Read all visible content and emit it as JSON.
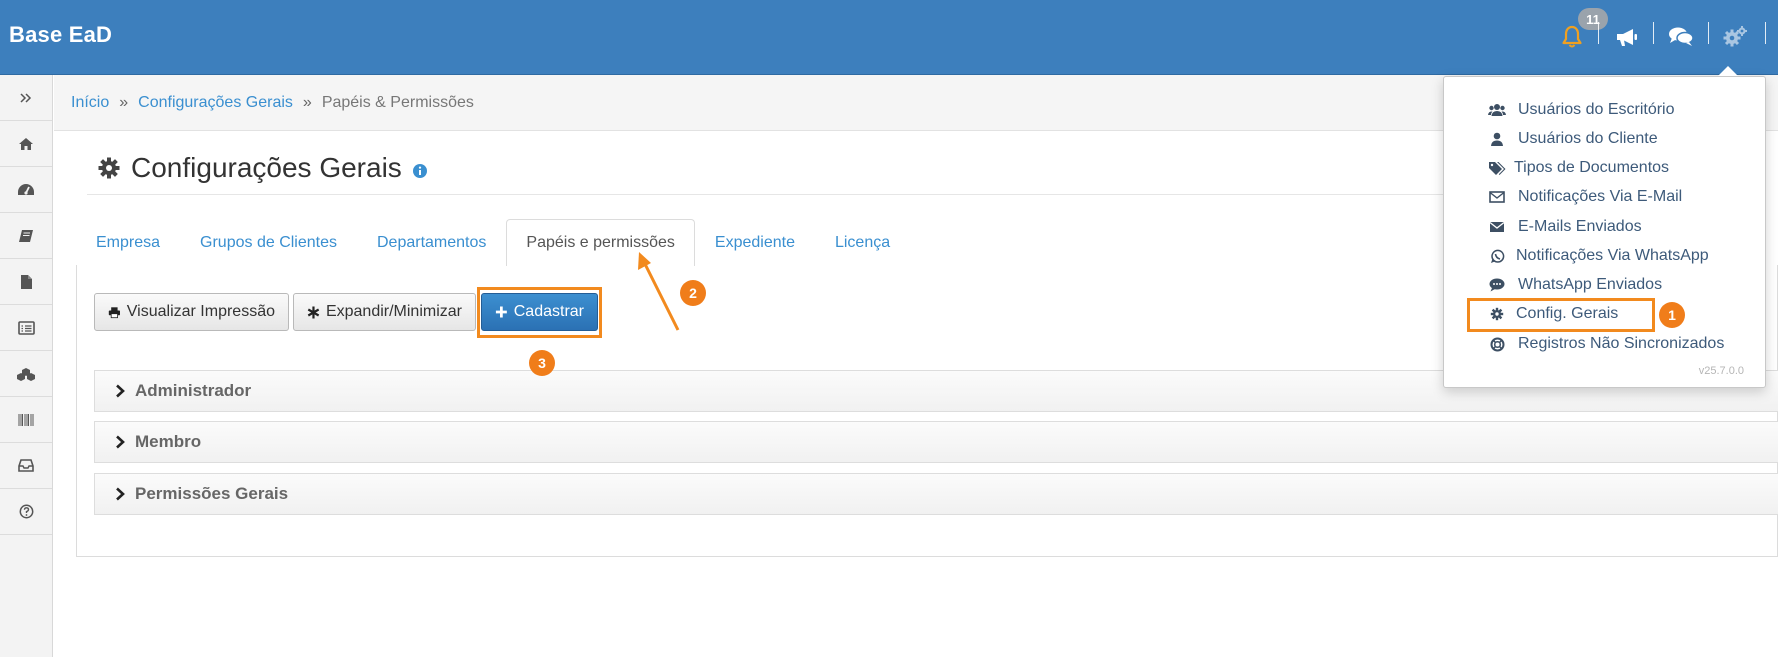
{
  "app": {
    "brand": "Base EaD"
  },
  "topbar": {
    "notification_count": "11"
  },
  "breadcrumb": {
    "items": [
      "Início",
      "Configurações Gerais",
      "Papéis & Permissões"
    ],
    "separator": "»"
  },
  "page": {
    "title": "Configurações Gerais"
  },
  "tabs": [
    {
      "label": "Empresa"
    },
    {
      "label": "Grupos de Clientes"
    },
    {
      "label": "Departamentos"
    },
    {
      "label": "Papéis e permissões",
      "active": true
    },
    {
      "label": "Expediente"
    },
    {
      "label": "Licença"
    }
  ],
  "toolbar": {
    "print_label": "Visualizar Impressão",
    "expand_label": "Expandir/Minimizar",
    "add_label": "Cadastrar"
  },
  "accordion": [
    {
      "label": "Administrador"
    },
    {
      "label": "Membro"
    },
    {
      "label": "Permissões Gerais"
    }
  ],
  "menu": {
    "items": [
      {
        "label": "Usuários do Escritório",
        "icon": "users-icon"
      },
      {
        "label": "Usuários do Cliente",
        "icon": "user-icon"
      },
      {
        "label": "Tipos de Documentos",
        "icon": "tags-icon"
      },
      {
        "label": "Notificações Via E-Mail",
        "icon": "envelope-outline-icon"
      },
      {
        "label": "E-Mails Enviados",
        "icon": "envelope-icon"
      },
      {
        "label": "Notificações Via WhatsApp",
        "icon": "whatsapp-icon"
      },
      {
        "label": "WhatsApp Enviados",
        "icon": "comment-dots-icon"
      },
      {
        "label": "Config. Gerais",
        "icon": "gear-icon"
      },
      {
        "label": "Registros Não Sincronizados",
        "icon": "life-ring-icon"
      }
    ],
    "version": "v25.7.0.0"
  },
  "annotations": {
    "step1": "1",
    "step2": "2",
    "step3": "3",
    "highlight_color": "#f28a1e"
  },
  "colors": {
    "navbar": "#3d7fbd",
    "link": "#3a8fd0",
    "primary_button": "#2f7bbf",
    "bell": "#f0a020"
  }
}
